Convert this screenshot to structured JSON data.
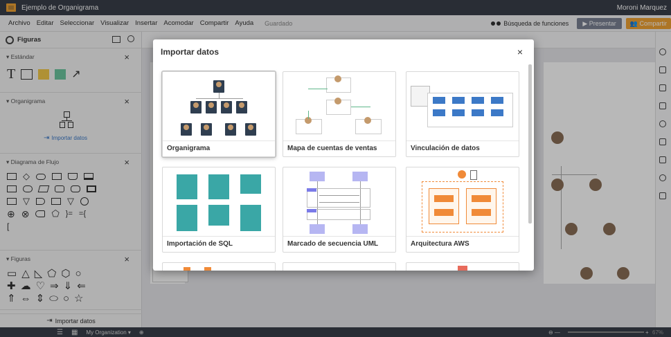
{
  "titlebar": {
    "doc_title": "Ejemplo de Organigrama",
    "user": "Moroni Marquez"
  },
  "menu": {
    "items": [
      "Archivo",
      "Editar",
      "Seleccionar",
      "Visualizar",
      "Insertar",
      "Acomodar",
      "Compartir",
      "Ayuda"
    ],
    "saved": "Guardado",
    "function_search": "Búsqueda de funciones",
    "present": "Presentar",
    "share": "Compartir"
  },
  "left_panel": {
    "title": "Figuras",
    "sections": {
      "standard": "Estándar",
      "org_chart": "Organigrama",
      "import_data": "Importar datos",
      "flowchart": "Diagrama de Flujo",
      "shapes": "Figuras"
    },
    "import_data_bottom": "Importar datos"
  },
  "bottombar": {
    "page_name": "My Organization",
    "zoom": "67%"
  },
  "modal": {
    "title": "Importar datos",
    "close": "×",
    "tiles": [
      {
        "label": "Organigrama"
      },
      {
        "label": "Mapa de cuentas de ventas"
      },
      {
        "label": "Vinculación de datos"
      },
      {
        "label": "Importación de SQL"
      },
      {
        "label": "Marcado de secuencia UML"
      },
      {
        "label": "Arquitectura AWS"
      }
    ]
  },
  "colors": {
    "accent": "#f0a234",
    "titlebar": "#3a3f4a",
    "teal": "#3aa7a6",
    "navy": "#2f3e50",
    "link": "#3c79c7"
  },
  "icons": [
    "app-logo-icon",
    "gear-icon",
    "image-icon",
    "search-icon",
    "close-icon",
    "binoculars-icon",
    "present-icon",
    "users-icon",
    "import-icon",
    "add-page-icon"
  ]
}
